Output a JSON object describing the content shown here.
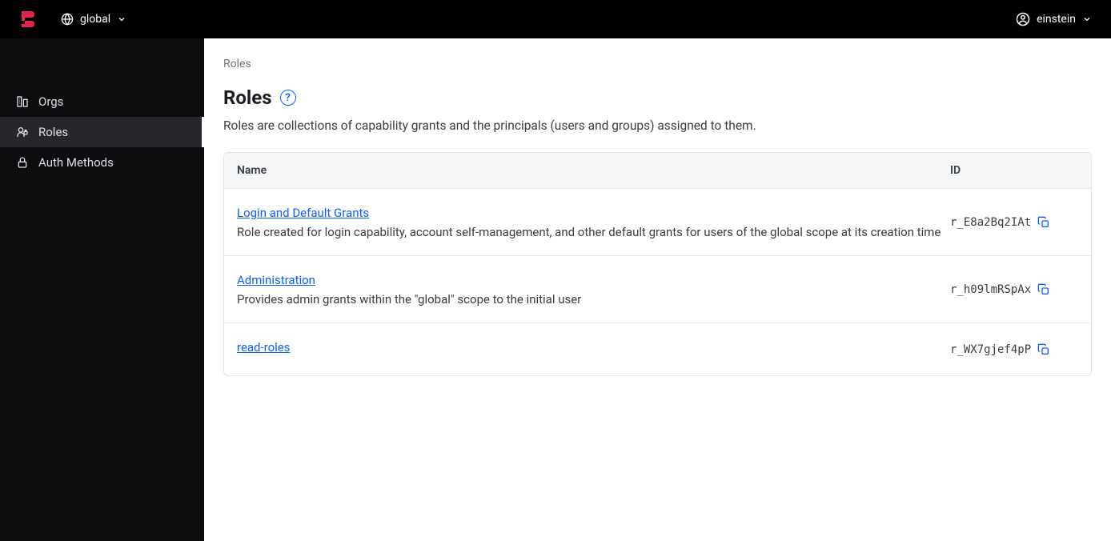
{
  "header": {
    "scope": "global",
    "user": "einstein"
  },
  "sidebar": {
    "items": [
      {
        "label": "Orgs",
        "icon": "orgs"
      },
      {
        "label": "Roles",
        "icon": "roles"
      },
      {
        "label": "Auth Methods",
        "icon": "lock"
      }
    ]
  },
  "breadcrumb": "Roles",
  "page": {
    "title": "Roles",
    "description": "Roles are collections of capability grants and the principals (users and groups) assigned to them."
  },
  "table": {
    "columns": {
      "name": "Name",
      "id": "ID"
    },
    "rows": [
      {
        "name": "Login and Default Grants",
        "description": "Role created for login capability, account self-management, and other default grants for users of the global scope at its creation time",
        "id": "r_E8a2Bq2IAt"
      },
      {
        "name": "Administration",
        "description": "Provides admin grants within the \"global\" scope to the initial user",
        "id": "r_h09lmRSpAx"
      },
      {
        "name": "read-roles",
        "description": "",
        "id": "r_WX7gjef4pP"
      }
    ]
  }
}
